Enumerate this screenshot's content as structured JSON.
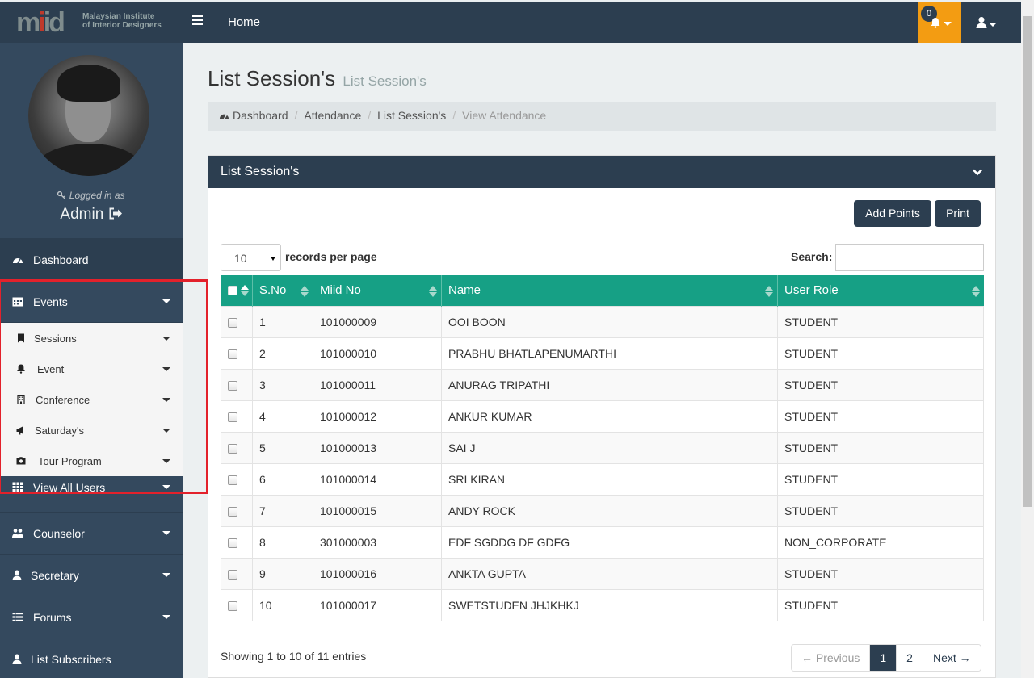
{
  "app": {
    "logo_mark": "mid",
    "logo_text_line1": "Malaysian Institute",
    "logo_text_line2": "of Interior Designers",
    "home_label": "Home",
    "notification_count": "0"
  },
  "sidebar": {
    "logged_in_label": "Logged in as",
    "user_name": "Admin",
    "items": [
      {
        "label": "Dashboard",
        "icon": "dashboard-icon"
      },
      {
        "label": "Events",
        "icon": "calendar-icon"
      },
      {
        "label": "View All Users",
        "icon": "grid-icon"
      },
      {
        "label": "Counselor",
        "icon": "users-icon"
      },
      {
        "label": "Secretary",
        "icon": "user-icon"
      },
      {
        "label": "Forums",
        "icon": "list-icon"
      },
      {
        "label": "List Subscribers",
        "icon": "user-icon"
      }
    ],
    "sub_items": [
      {
        "label": "Sessions",
        "icon": "bookmark-icon"
      },
      {
        "label": "Event",
        "icon": "bell-icon"
      },
      {
        "label": "Conference",
        "icon": "building-icon"
      },
      {
        "label": "Saturday's",
        "icon": "bullhorn-icon"
      },
      {
        "label": "Tour Program",
        "icon": "camera-icon"
      }
    ]
  },
  "page": {
    "title": "List Session's",
    "subtitle": "List Session's"
  },
  "breadcrumb": [
    "Dashboard",
    "Attendance",
    "List Session's",
    "View Attendance"
  ],
  "panel": {
    "title": "List Session's",
    "add_points_label": "Add Points",
    "print_label": "Print",
    "records_per_page_value": "10",
    "records_per_page_label": "records per page",
    "search_label": "Search:",
    "search_value": ""
  },
  "table": {
    "columns": [
      "S.No",
      "Miid No",
      "Name",
      "User Role"
    ],
    "rows": [
      {
        "sno": "1",
        "miid": "101000009",
        "name": "OOI BOON",
        "role": "STUDENT"
      },
      {
        "sno": "2",
        "miid": "101000010",
        "name": "PRABHU BHATLAPENUMARTHI",
        "role": "STUDENT"
      },
      {
        "sno": "3",
        "miid": "101000011",
        "name": "ANURAG TRIPATHI",
        "role": "STUDENT"
      },
      {
        "sno": "4",
        "miid": "101000012",
        "name": "ANKUR KUMAR",
        "role": "STUDENT"
      },
      {
        "sno": "5",
        "miid": "101000013",
        "name": "SAI J",
        "role": "STUDENT"
      },
      {
        "sno": "6",
        "miid": "101000014",
        "name": "SRI KIRAN",
        "role": "STUDENT"
      },
      {
        "sno": "7",
        "miid": "101000015",
        "name": "ANDY ROCK",
        "role": "STUDENT"
      },
      {
        "sno": "8",
        "miid": "301000003",
        "name": "EDF SGDDG DF GDFG",
        "role": "NON_CORPORATE"
      },
      {
        "sno": "9",
        "miid": "101000016",
        "name": "ANKTA GUPTA",
        "role": "STUDENT"
      },
      {
        "sno": "10",
        "miid": "101000017",
        "name": "SWETSTUDEN JHJKHKJ",
        "role": "STUDENT"
      }
    ]
  },
  "footer": {
    "info": "Showing 1 to 10 of 11 entries",
    "prev_label": "← Previous",
    "pages": [
      "1",
      "2"
    ],
    "next_label": "Next →"
  },
  "colors": {
    "navbar": "#2c3e50",
    "sidebar": "#34495e",
    "table_header": "#16a085",
    "notification": "#f39c12",
    "highlight": "#e3212b"
  }
}
